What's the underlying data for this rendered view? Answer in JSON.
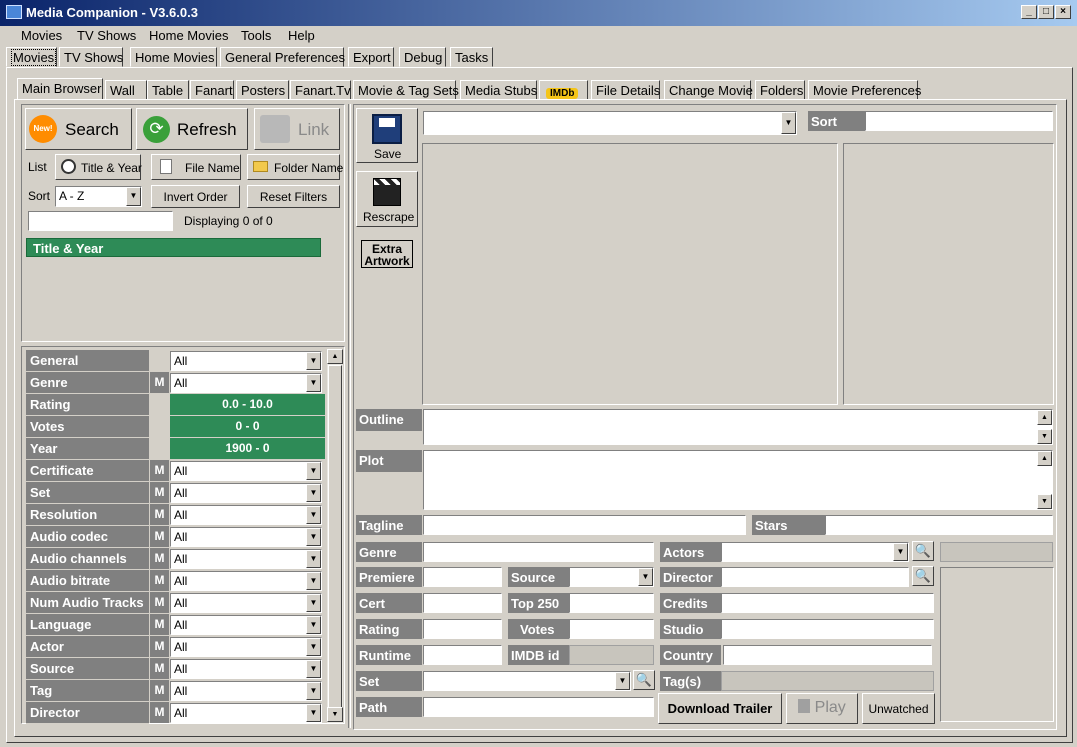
{
  "window": {
    "title": "Media Companion - V3.6.0.3",
    "controls": [
      "_",
      "□",
      "×"
    ]
  },
  "menu": [
    "Movies",
    "TV Shows",
    "Home Movies",
    "Tools",
    "Help"
  ],
  "main_tabs": [
    "Movies",
    "TV Shows",
    "Home Movies",
    "General Preferences",
    "Export",
    "Debug",
    "Tasks"
  ],
  "sub_tabs": [
    "Main Browser",
    "Wall",
    "Table",
    "Fanart",
    "Posters",
    "Fanart.Tv",
    "Movie & Tag Sets",
    "Media Stubs",
    "IMDb",
    "File Details",
    "Change Movie",
    "Folders",
    "Movie Preferences"
  ],
  "browser": {
    "search_btn": "Search",
    "refresh_btn": "Refresh",
    "link_btn": "Link",
    "new_badge": "New!",
    "list_label": "List",
    "list_title_year": "Title & Year",
    "list_file_name": "File Name",
    "list_folder_name": "Folder Name",
    "sort_label": "Sort",
    "sort_value": "A - Z",
    "invert_order": "Invert Order",
    "reset_filters": "Reset Filters",
    "displaying": "Displaying 0 of 0",
    "list_header": "Title & Year"
  },
  "filters": [
    {
      "label": "General",
      "m": "",
      "value": "All",
      "type": "combo"
    },
    {
      "label": "Genre",
      "m": "M",
      "value": "All",
      "type": "combo"
    },
    {
      "label": "Rating",
      "m": "",
      "value": "0.0 - 10.0",
      "type": "range"
    },
    {
      "label": "Votes",
      "m": "",
      "value": "0 - 0",
      "type": "range"
    },
    {
      "label": "Year",
      "m": "",
      "value": "1900 - 0",
      "type": "range"
    },
    {
      "label": "Certificate",
      "m": "M",
      "value": "All",
      "type": "combo"
    },
    {
      "label": "Set",
      "m": "M",
      "value": "All",
      "type": "combo"
    },
    {
      "label": "Resolution",
      "m": "M",
      "value": "All",
      "type": "combo"
    },
    {
      "label": "Audio codec",
      "m": "M",
      "value": "All",
      "type": "combo"
    },
    {
      "label": "Audio channels",
      "m": "M",
      "value": "All",
      "type": "combo"
    },
    {
      "label": "Audio bitrate",
      "m": "M",
      "value": "All",
      "type": "combo"
    },
    {
      "label": "Num Audio Tracks",
      "m": "M",
      "value": "All",
      "type": "combo"
    },
    {
      "label": "Language",
      "m": "M",
      "value": "All",
      "type": "combo"
    },
    {
      "label": "Actor",
      "m": "M",
      "value": "All",
      "type": "combo"
    },
    {
      "label": "Source",
      "m": "M",
      "value": "All",
      "type": "combo"
    },
    {
      "label": "Tag",
      "m": "M",
      "value": "All",
      "type": "combo"
    },
    {
      "label": "Director",
      "m": "M",
      "value": "All",
      "type": "combo"
    }
  ],
  "details": {
    "save": "Save",
    "rescrape": "Rescrape",
    "extra_artwork_1": "Extra",
    "extra_artwork_2": "Artwork",
    "sort_label": "Sort",
    "outline": "Outline",
    "plot": "Plot",
    "tagline": "Tagline",
    "stars": "Stars",
    "genre": "Genre",
    "actors": "Actors",
    "premiere": "Premiere",
    "source": "Source",
    "director": "Director",
    "cert": "Cert",
    "top250": "Top 250",
    "credits": "Credits",
    "rating": "Rating",
    "votes": "Votes",
    "studio": "Studio",
    "runtime": "Runtime",
    "imdb_id": "IMDB id",
    "country": "Country",
    "set": "Set",
    "tags": "Tag(s)",
    "path": "Path",
    "download_trailer": "Download Trailer",
    "play": "Play",
    "unwatched": "Unwatched"
  },
  "colors": {
    "title_start": "#0a246a",
    "title_end": "#a6caf0",
    "list_header_green": "#2e8b57",
    "label_grey": "#808080"
  }
}
